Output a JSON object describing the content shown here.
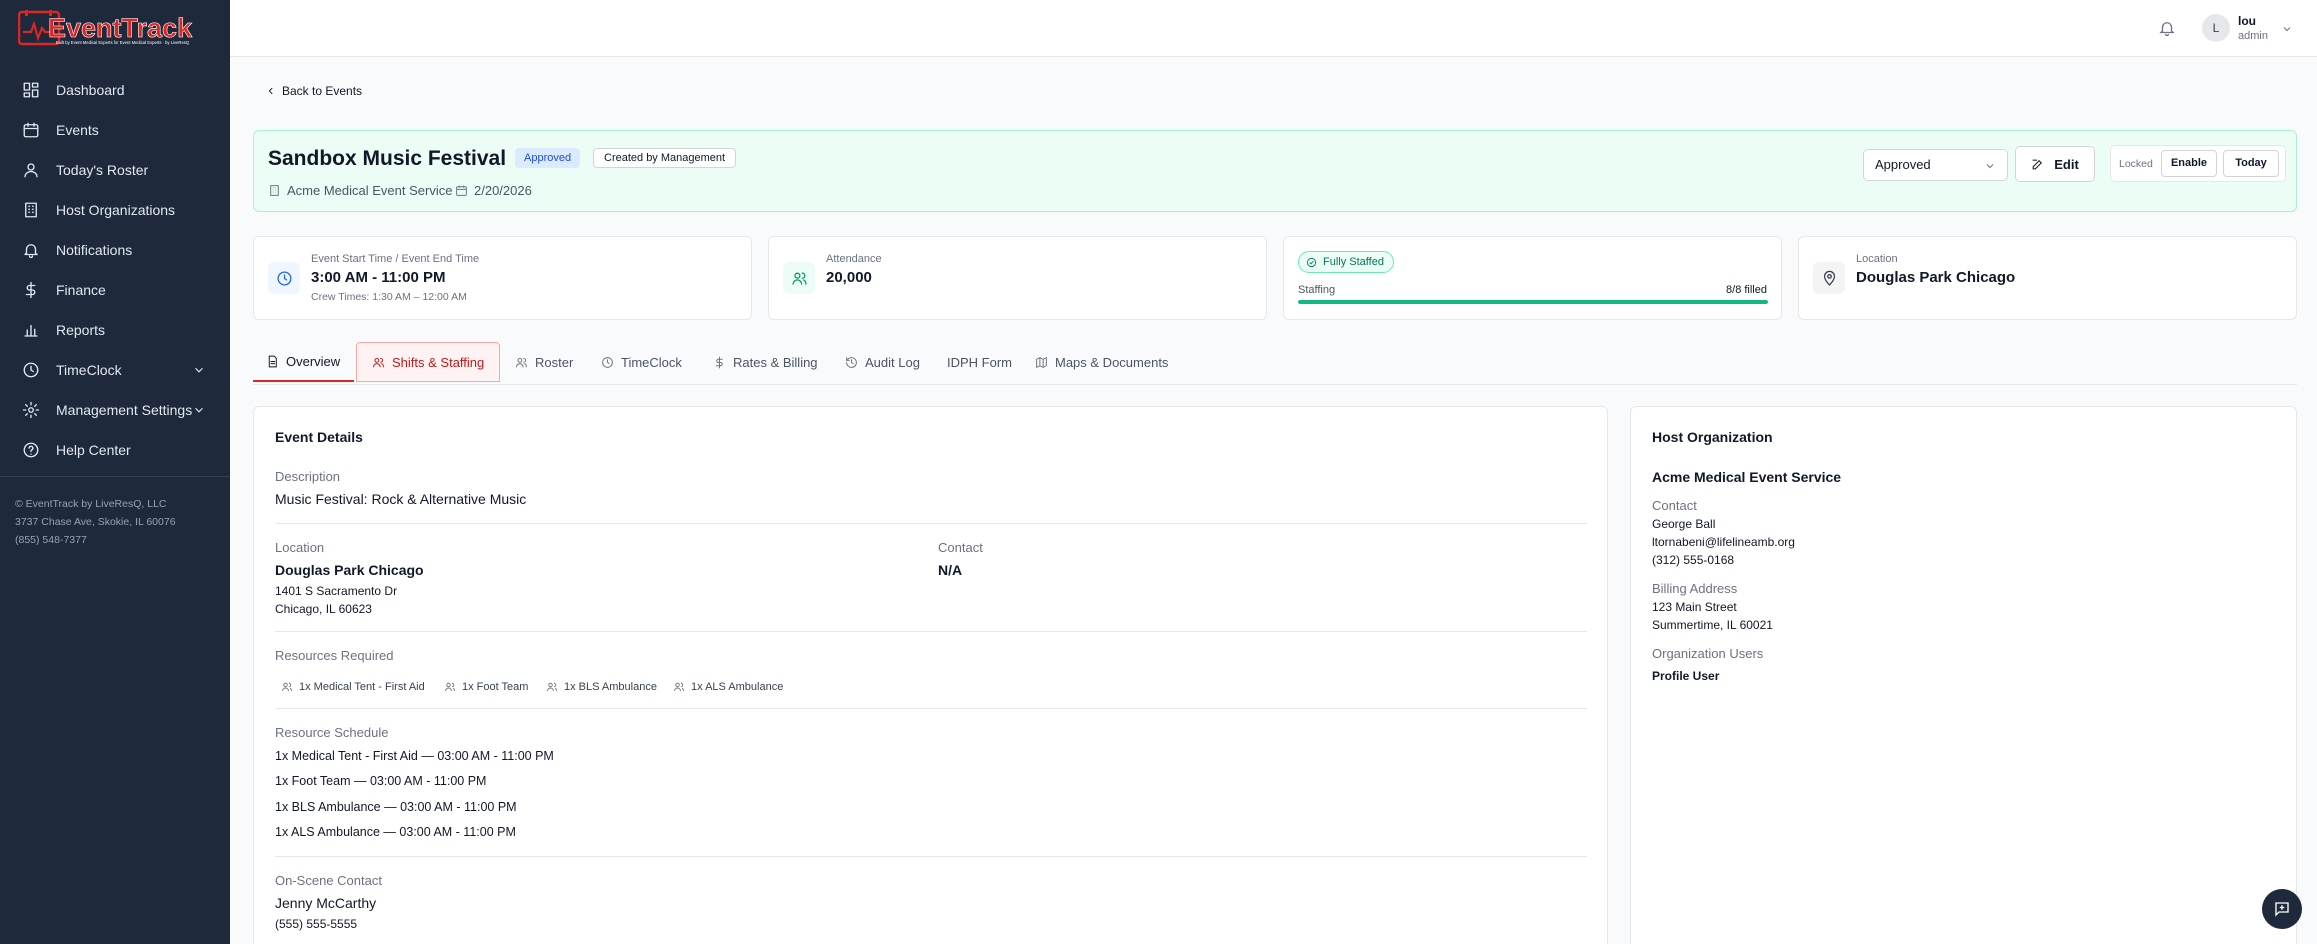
{
  "brand": {
    "name": "EventTrack",
    "tagline": "Built by Event Medical Experts for Event Medical Experts · by LiveResQ"
  },
  "sidebar": {
    "items": [
      {
        "label": "Dashboard",
        "icon": "dashboard-icon"
      },
      {
        "label": "Events",
        "icon": "calendar-icon"
      },
      {
        "label": "Today's Roster",
        "icon": "users-icon"
      },
      {
        "label": "Host Organizations",
        "icon": "building-icon"
      },
      {
        "label": "Notifications",
        "icon": "bell-icon"
      },
      {
        "label": "Finance",
        "icon": "dollar-icon"
      },
      {
        "label": "Reports",
        "icon": "bar-chart-icon"
      },
      {
        "label": "TimeClock",
        "icon": "clock-icon"
      },
      {
        "label": "Management Settings",
        "icon": "gear-icon"
      },
      {
        "label": "Help Center",
        "icon": "help-icon"
      }
    ],
    "footer": [
      "© EventTrack by LiveResQ, LLC",
      "3737 Chase Ave, Skokie, IL 60076",
      "(855) 548-7377"
    ]
  },
  "topbar": {
    "user_initial": "L",
    "user_name": "lou",
    "user_role": "admin"
  },
  "back_label": "Back to Events",
  "event": {
    "title": "Sandbox Music Festival",
    "status_badge": "Approved",
    "created_badge": "Created by Management",
    "organization": "Acme Medical Event Service",
    "date": "2/20/2026",
    "status_select": "Approved",
    "edit_label": "Edit",
    "locked_label": "Locked",
    "enable_label": "Enable",
    "today_label": "Today"
  },
  "stats": {
    "time": {
      "label": "Event Start Time / Event End Time",
      "value": "3:00 AM - 11:00 PM",
      "sub": "Crew Times: 1:30 AM – 12:00 AM"
    },
    "attendance": {
      "label": "Attendance",
      "value": "20,000"
    },
    "staffing": {
      "badge": "Fully Staffed",
      "label": "Staffing",
      "count": "8/8 filled",
      "fill_percent": 100
    },
    "location": {
      "label": "Location",
      "value": "Douglas Park Chicago"
    }
  },
  "tabs": [
    {
      "label": "Overview"
    },
    {
      "label": "Shifts & Staffing"
    },
    {
      "label": "Roster"
    },
    {
      "label": "TimeClock"
    },
    {
      "label": "Rates & Billing"
    },
    {
      "label": "Audit Log"
    },
    {
      "label": "IDPH Form"
    },
    {
      "label": "Maps & Documents"
    }
  ],
  "details": {
    "title": "Event Details",
    "description_label": "Description",
    "description": "Music Festival: Rock & Alternative Music",
    "location_label": "Location",
    "location_name": "Douglas Park Chicago",
    "location_street": "1401 S Sacramento Dr",
    "location_city": "Chicago, IL 60623",
    "contact_label": "Contact",
    "contact_value": "N/A",
    "resources_label": "Resources Required",
    "resources": [
      "1x Medical Tent - First Aid",
      "1x Foot Team",
      "1x BLS Ambulance",
      "1x ALS Ambulance"
    ],
    "schedule_label": "Resource Schedule",
    "schedule": [
      "1x Medical Tent - First Aid — 03:00 AM - 11:00 PM",
      "1x Foot Team — 03:00 AM - 11:00 PM",
      "1x BLS Ambulance — 03:00 AM - 11:00 PM",
      "1x ALS Ambulance — 03:00 AM - 11:00 PM"
    ],
    "onscene_label": "On-Scene Contact",
    "onscene_name": "Jenny McCarthy",
    "onscene_phone": "(555) 555-5555"
  },
  "host": {
    "title": "Host Organization",
    "name": "Acme Medical Event Service",
    "contact_label": "Contact",
    "contact_name": "George Ball",
    "contact_email": "ltornabeni@lifelineamb.org",
    "contact_phone": "(312) 555-0168",
    "billing_label": "Billing Address",
    "billing_street": "123 Main Street",
    "billing_city": "Summertime, IL 60021",
    "users_label": "Organization Users",
    "users_value": "Profile User"
  },
  "colors": {
    "sidebar_bg": "#1e293b",
    "accent_red": "#dc2626",
    "success_green": "#10b981",
    "approved_blue": "#1d4ed8"
  }
}
